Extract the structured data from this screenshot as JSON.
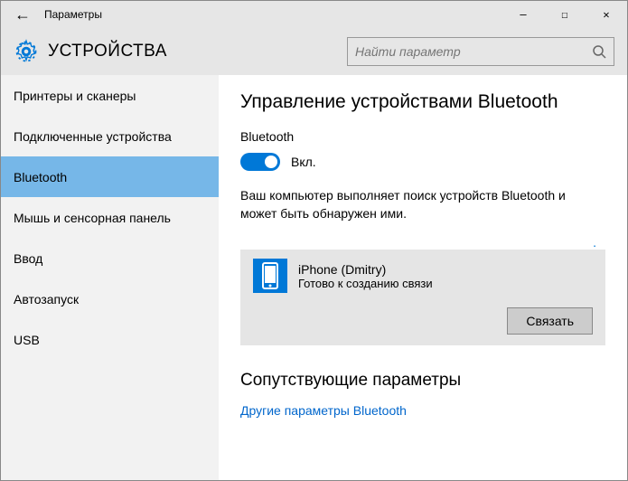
{
  "window": {
    "title": "Параметры"
  },
  "header": {
    "label": "УСТРОЙСТВА",
    "search_placeholder": "Найти параметр"
  },
  "sidebar": {
    "items": [
      {
        "label": "Принтеры и сканеры"
      },
      {
        "label": "Подключенные устройства"
      },
      {
        "label": "Bluetooth"
      },
      {
        "label": "Мышь и сенсорная панель"
      },
      {
        "label": "Ввод"
      },
      {
        "label": "Автозапуск"
      },
      {
        "label": "USB"
      }
    ],
    "active_index": 2
  },
  "main": {
    "title": "Управление устройствами Bluetooth",
    "toggle_label": "Bluetooth",
    "toggle_state": "Вкл.",
    "toggle_on": true,
    "description": "Ваш компьютер выполняет поиск устройств Bluetooth и может быть обнаружен ими.",
    "device": {
      "name": "iPhone (Dmitry)",
      "status": "Готово к созданию связи",
      "icon": "phone-icon"
    },
    "pair_button": "Связать",
    "related_title": "Сопутствующие параметры",
    "related_link": "Другие параметры Bluetooth"
  }
}
